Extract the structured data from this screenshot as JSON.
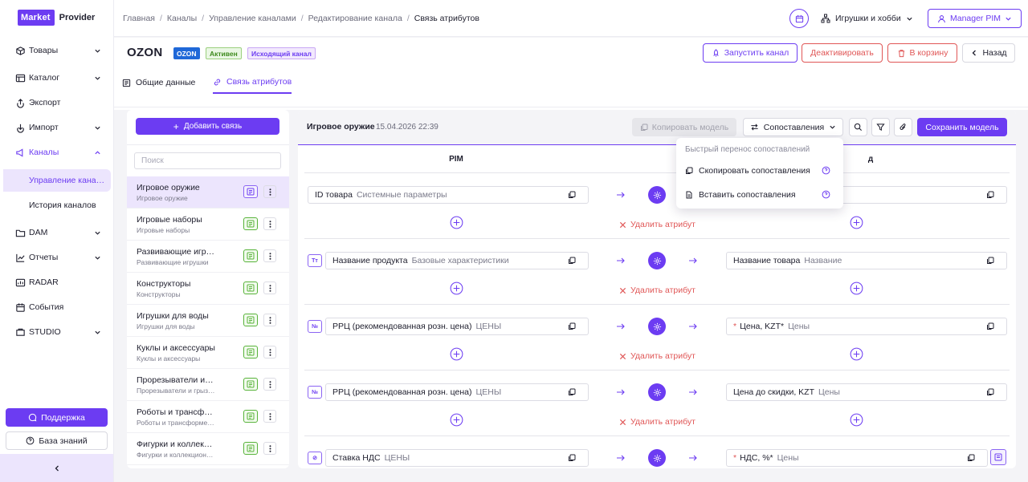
{
  "logo": {
    "brand": "Market",
    "product": "Provider"
  },
  "sidebar": {
    "items": [
      {
        "label": "Товары",
        "icon": "box-icon",
        "expandable": true
      },
      {
        "label": "Каталог",
        "icon": "catalog-icon",
        "expandable": true
      },
      {
        "label": "Экспорт",
        "icon": "export-icon",
        "expandable": false
      },
      {
        "label": "Импорт",
        "icon": "import-icon",
        "expandable": true
      },
      {
        "label": "Каналы",
        "icon": "channels-icon",
        "expandable": true,
        "expanded": true
      },
      {
        "label": "DAM",
        "icon": "folder-icon",
        "expandable": true
      },
      {
        "label": "Отчеты",
        "icon": "chart-icon",
        "expandable": true
      },
      {
        "label": "RADAR",
        "icon": "radar-icon",
        "expandable": false
      },
      {
        "label": "События",
        "icon": "calendar-icon",
        "expandable": false
      },
      {
        "label": "STUDIO",
        "icon": "studio-icon",
        "expandable": true
      }
    ],
    "sub_items": [
      {
        "label": "Управление каналами",
        "selected": true
      },
      {
        "label": "История каналов",
        "selected": false
      }
    ],
    "support_label": "Поддержка",
    "kb_label": "База знаний"
  },
  "breadcrumbs": [
    "Главная",
    "Каналы",
    "Управление каналами",
    "Редактирование канала",
    "Связь атрибутов"
  ],
  "topbar": {
    "store": "Игрушки и хобби",
    "user": "Manager PIM"
  },
  "channel": {
    "title": "OZON",
    "badges": [
      "OZON",
      "Активен",
      "Исходящий канал"
    ],
    "actions": {
      "run": "Запустить канал",
      "deactivate": "Деактивировать",
      "trash": "В корзину",
      "back": "Назад"
    },
    "tabs": [
      {
        "label": "Общие данные",
        "active": false
      },
      {
        "label": "Связь атрибутов",
        "active": true
      }
    ]
  },
  "left_panel": {
    "add_label": "Добавить связь",
    "search_placeholder": "Поиск",
    "categories": [
      {
        "title": "Игровое оружие",
        "subtitle": "Игровое оружие",
        "selected": true,
        "status": "purple"
      },
      {
        "title": "Игровые наборы",
        "subtitle": "Игровые наборы",
        "selected": false,
        "status": "green"
      },
      {
        "title": "Развивающие игрушки",
        "subtitle": "Развивающие игрушки",
        "selected": false,
        "status": "green"
      },
      {
        "title": "Конструкторы",
        "subtitle": "Конструкторы",
        "selected": false,
        "status": "green"
      },
      {
        "title": "Игрушки для воды",
        "subtitle": "Игрушки для воды",
        "selected": false,
        "status": "green"
      },
      {
        "title": "Куклы и аксессуары",
        "subtitle": "Куклы и аксессуары",
        "selected": false,
        "status": "green"
      },
      {
        "title": "Прорезыватели и грызунки",
        "subtitle": "Прорезыватели и грызунки",
        "selected": false,
        "status": "green"
      },
      {
        "title": "Роботы и трансформеры",
        "subtitle": "Роботы и трансформеры",
        "selected": false,
        "status": "green"
      },
      {
        "title": "Фигурки и коллекционные",
        "subtitle": "Фигурки и коллекционные",
        "selected": false,
        "status": "green"
      }
    ]
  },
  "mapping": {
    "model_name": "Игровое оружие",
    "model_date": "15.04.2026 22:39",
    "copy_model": "Копировать модель",
    "compare": "Сопоставления",
    "save": "Сохранить модель",
    "col_pim": "PIM",
    "col_channel": "д",
    "delete_label": "Удалить атрибут",
    "rows": [
      {
        "type_icon": "",
        "pim_name": "ID товара",
        "pim_group": "Системные параметры",
        "ch_required": "",
        "ch_name": "",
        "ch_group": "",
        "deletable": true
      },
      {
        "type_icon": "Tт",
        "pim_name": "Название продукта",
        "pim_group": "Базовые характеристики",
        "ch_required": "",
        "ch_name": "Название товара",
        "ch_group": "Название",
        "deletable": true
      },
      {
        "type_icon": "№",
        "pim_name": "РРЦ (рекомендованная розн. цена)",
        "pim_group": "ЦЕНЫ",
        "ch_required": "*",
        "ch_name": "Цена, KZT*",
        "ch_group": "Цены",
        "deletable": true
      },
      {
        "type_icon": "№",
        "pim_name": "РРЦ (рекомендованная розн. цена)",
        "pim_group": "ЦЕНЫ",
        "ch_required": "",
        "ch_name": "Цена до скидки, KZT",
        "ch_group": "Цены",
        "deletable": true
      },
      {
        "type_icon": "⊘",
        "pim_name": "Ставка НДС",
        "pim_group": "ЦЕНЫ",
        "ch_required": "*",
        "ch_name": "НДС, %*",
        "ch_group": "Цены",
        "deletable": false
      }
    ]
  },
  "dropdown": {
    "title": "Быстрый перенос сопоставлений",
    "items": [
      {
        "label": "Скопировать сопоставления",
        "icon": "copy-icon"
      },
      {
        "label": "Вставить сопоставления",
        "icon": "paste-icon"
      }
    ]
  },
  "colors": {
    "accent": "#6c3cf2",
    "danger": "#e05656",
    "success": "#58b33a",
    "ozon": "#1f68d8"
  }
}
